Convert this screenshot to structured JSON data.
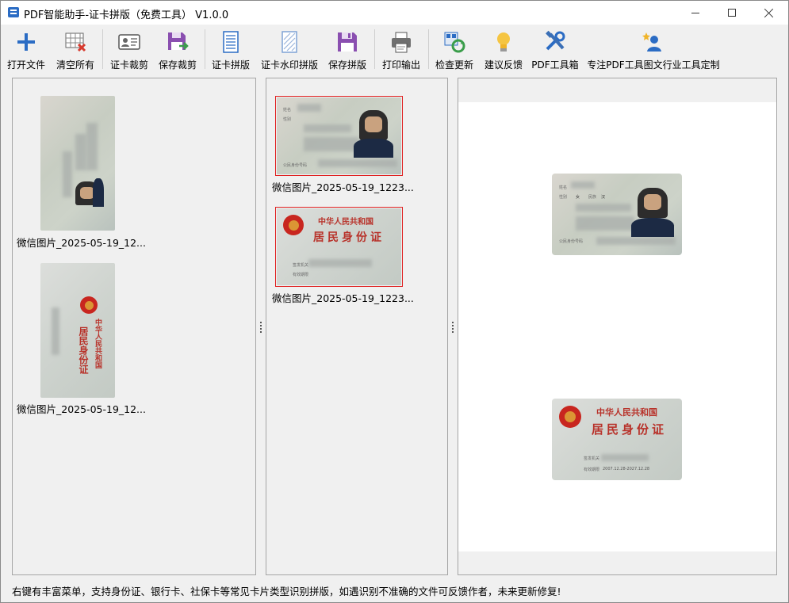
{
  "window": {
    "title": "PDF智能助手-证卡拼版（免费工具） V1.0.0"
  },
  "toolbar": {
    "items": [
      {
        "label": "打开文件",
        "icon": "plus-icon"
      },
      {
        "label": "清空所有",
        "icon": "clear-grid-icon"
      },
      {
        "label": "证卡裁剪",
        "icon": "id-card-icon"
      },
      {
        "label": "保存裁剪",
        "icon": "save-export-icon"
      },
      {
        "label": "证卡拼版",
        "icon": "document-icon"
      },
      {
        "label": "证卡水印拼版",
        "icon": "watermark-doc-icon"
      },
      {
        "label": "保存拼版",
        "icon": "save-icon"
      },
      {
        "label": "打印输出",
        "icon": "printer-icon"
      },
      {
        "label": "检查更新",
        "icon": "update-icon"
      },
      {
        "label": "建议反馈",
        "icon": "lightbulb-icon"
      },
      {
        "label": "PDF工具箱",
        "icon": "tools-icon"
      },
      {
        "label": "专注PDF工具图文行业工具定制",
        "icon": "user-star-icon"
      }
    ]
  },
  "source_panel": {
    "items": [
      {
        "caption": "微信图片_2025-05-19_12..."
      },
      {
        "caption": "微信图片_2025-05-19_12..."
      }
    ]
  },
  "cropped_panel": {
    "items": [
      {
        "caption": "微信图片_2025-05-19_1223..."
      },
      {
        "caption": "微信图片_2025-05-19_1223..."
      }
    ]
  },
  "card_text": {
    "country": "中华人民共和国",
    "card_name": "居民身份证",
    "gender_label": "性别",
    "gender_value": "女",
    "ethnicity_label": "民族",
    "ethnicity_value": "汉",
    "id_label": "公民身份号码",
    "authority_label": "签发机关",
    "validity_label": "有效期限",
    "validity_value": "2007.12.28-2027.12.28"
  },
  "status_bar": {
    "text": "右键有丰富菜单，支持身份证、银行卡、社保卡等常见卡片类型识别拼版，如遇识别不准确的文件可反馈作者，未来更新修复!"
  },
  "colors": {
    "accent_blue": "#2b6cc4",
    "purple": "#8a4fb0",
    "selection_red": "#e02020"
  }
}
